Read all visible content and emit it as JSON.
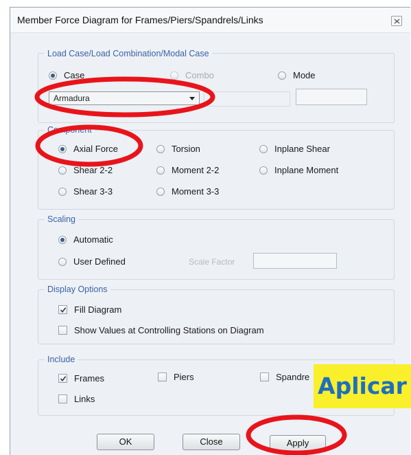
{
  "window": {
    "title": "Member Force Diagram for Frames/Piers/Spandrels/Links"
  },
  "load_case": {
    "legend": "Load Case/Load Combination/Modal Case",
    "case_label": "Case",
    "combo_label": "Combo",
    "mode_label": "Mode",
    "selected": "Case",
    "case_value": "Armadura"
  },
  "component": {
    "legend": "Component",
    "options": [
      "Axial Force",
      "Torsion",
      "Inplane Shear",
      "Shear 2-2",
      "Moment 2-2",
      "Inplane Moment",
      "Shear 3-3",
      "Moment 3-3"
    ],
    "selected": "Axial Force"
  },
  "scaling": {
    "legend": "Scaling",
    "automatic_label": "Automatic",
    "user_defined_label": "User Defined",
    "scale_factor_label": "Scale Factor",
    "selected": "Automatic"
  },
  "display_options": {
    "legend": "Display Options",
    "fill_diagram_label": "Fill Diagram",
    "fill_diagram_checked": true,
    "show_values_label": "Show Values at Controlling Stations on Diagram",
    "show_values_checked": false
  },
  "include": {
    "legend": "Include",
    "frames_label": "Frames",
    "frames_checked": true,
    "piers_label": "Piers",
    "piers_checked": false,
    "spandrels_label": "Spandre",
    "spandrels_checked": false,
    "links_label": "Links",
    "links_checked": false
  },
  "buttons": {
    "ok": "OK",
    "close": "Close",
    "apply": "Apply"
  },
  "annotation": {
    "label": "Aplicar",
    "highlight_color": "#e8141b",
    "label_bg": "#f9ef2b",
    "label_color": "#1e6fbf"
  }
}
